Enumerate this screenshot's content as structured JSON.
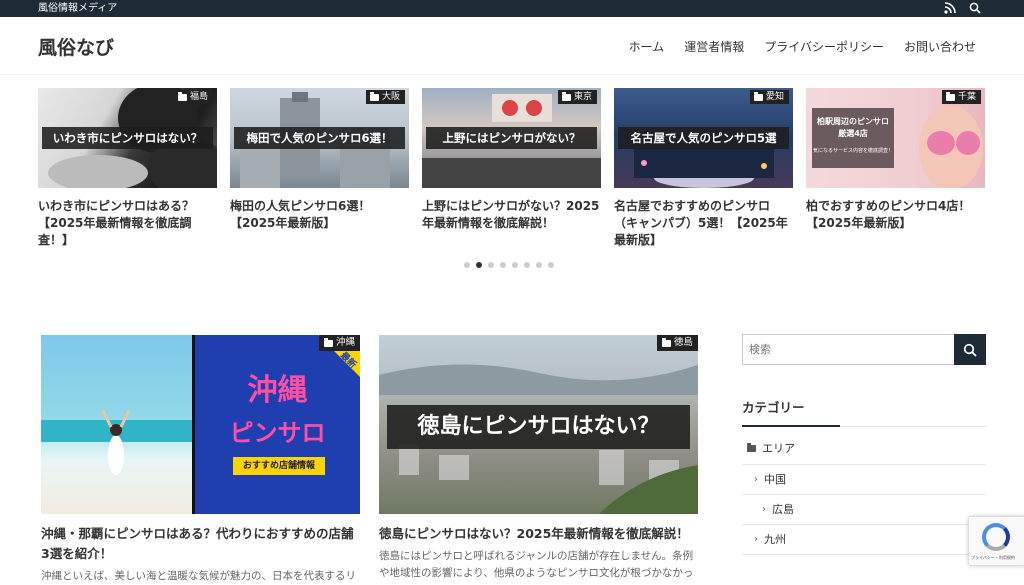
{
  "topbar": {
    "tagline": "風俗情報メディア",
    "icons": [
      "rss-icon",
      "search-icon"
    ]
  },
  "header": {
    "logo": "風俗なび",
    "nav": [
      "ホーム",
      "運営者情報",
      "プライバシーポリシー",
      "お問い合わせ"
    ]
  },
  "slider": {
    "slides": [
      {
        "category": "福島",
        "banner": "いわき市にピンサロはない？",
        "title": "いわき市にピンサロはある？【2025年最新情報を徹底調査！】"
      },
      {
        "category": "大阪",
        "banner": "梅田で人気のピンサロ6選！",
        "title": "梅田の人気ピンサロ6選！【2025年最新版】"
      },
      {
        "category": "東京",
        "banner": "上野にはピンサロがない？",
        "title": "上野にはピンサロがない？2025年最新情報を徹底解説！"
      },
      {
        "category": "愛知",
        "banner": "名古屋で人気のピンサロ5選",
        "title": "名古屋でおすすめのピンサロ（キャンパブ）5選！【2025年最新版】"
      },
      {
        "category": "千葉",
        "banner": "柏駅周辺のピンサロ厳選4店",
        "banner_sub": "気になるサービス内容を徹底調査！",
        "title": "柏でおすすめのピンサロ4店！【2025年最新版】"
      }
    ],
    "dots": 8,
    "active_dot": 1
  },
  "cards": [
    {
      "category": "沖縄",
      "thumb_title_1": "沖縄",
      "thumb_title_2": "ピンサロ",
      "thumb_badge": "おすすめ店舗情報",
      "thumb_corner": "最新",
      "title": "沖縄・那覇にピンサロはある？代わりにおすすめの店舗3選を紹介！",
      "excerpt": "沖縄といえば、美しい海と温暖な気候が魅力の、日本を代表するリ"
    },
    {
      "category": "徳島",
      "thumb_banner": "徳島にピンサロはない？",
      "title": "徳島にピンサロはない？2025年最新情報を徹底解説！",
      "excerpt": "徳島にはピンサロと呼ばれるジャンルの店舗が存在しません。条例や地域性の影響により、他県のようなピンサロ文化が根づかなかっ"
    }
  ],
  "sidebar": {
    "search_placeholder": "検索",
    "widget_title": "カテゴリー",
    "categories": [
      {
        "label": "エリア",
        "level": 0
      },
      {
        "label": "中国",
        "level": 1
      },
      {
        "label": "広島",
        "level": 2
      },
      {
        "label": "九州",
        "level": 1
      }
    ]
  },
  "recaptcha": {
    "text": "プライバシー・利用規約"
  },
  "colors": {
    "dark": "#1e2a36",
    "okinawa_blue": "#1f3fb0",
    "okinawa_pink": "#ff4fa3",
    "badge_yellow": "#ffd400"
  }
}
